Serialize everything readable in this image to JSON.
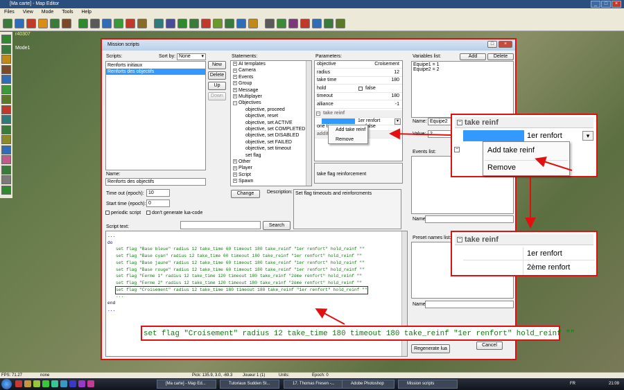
{
  "app": {
    "title": "[Ma carte] - Map Editor",
    "menu": [
      "Files",
      "View",
      "Mode",
      "Tools",
      "Help"
    ],
    "viewport_label": "r40307",
    "mode_label": "Mode1"
  },
  "dialog": {
    "title": "Mission scripts",
    "scripts_label": "Scripts:",
    "sort_label": "Sort by:",
    "sort_value": "None",
    "scripts": [
      "Renforts initiaux",
      "Renforts des objectifs"
    ],
    "buttons": {
      "new": "New",
      "delete": "Delete",
      "up": "Up",
      "down": "Down"
    },
    "name_label": "Name:",
    "name_value": "Renforts des objectifs",
    "timeout_label": "Time out (epoch):",
    "timeout_value": "10",
    "start_label": "Start time (epoch):",
    "start_value": "0",
    "periodic_label": "periodic script",
    "nolua_label": "don't generate lua-code",
    "script_text_label": "Script text:",
    "search_btn": "Search",
    "statements_label": "Statements:",
    "statements_top": [
      "AI templates",
      "Camera",
      "Events",
      "Group",
      "Message",
      "Multiplayer"
    ],
    "objectives_label": "Objectives",
    "objectives_children": [
      "objective, proceed",
      "objective, reset",
      "objective, set ACTIVE",
      "objective, set COMPLETED",
      "objective, set DISABLED",
      "objective, set FAILED",
      "objective, set timeout",
      "set flag"
    ],
    "statements_bottom": [
      "Other",
      "Player",
      "Script",
      "Spawn"
    ],
    "change_btn": "Change",
    "description_label": "Description:",
    "description_text": "Set flag timeouts and reinforcments",
    "parameters_label": "Parameters:",
    "params": [
      {
        "k": "objective",
        "v": "Croisement"
      },
      {
        "k": "radius",
        "v": "12"
      },
      {
        "k": "take time",
        "v": "180"
      },
      {
        "k": "hold",
        "v": "false"
      },
      {
        "k": "timeout",
        "v": "180"
      },
      {
        "k": "alliance",
        "v": "-1"
      }
    ],
    "take_reinf_label": "take reinf",
    "take_reinf_value": "1er renfort",
    "one_time_label": "one time",
    "one_time_value": "false",
    "additional_label": "additional objectives",
    "param_desc": "take flag reinforcement",
    "context_menu": [
      "Add take reinf",
      "Remove"
    ],
    "variables_label": "Variables list:",
    "var_add": "Add",
    "var_delete": "Delete",
    "variables": [
      "Equipe1 = 1",
      "Equipe2 = 2"
    ],
    "var_name_label": "Name:",
    "var_name_value": "Equipe2",
    "var_value_label": "Value:",
    "var_value_value": "2",
    "events_label": "Events list:",
    "events_name_label": "Name:",
    "preset_label": "Preset names list:",
    "preset_name_label": "Name:",
    "regen_btn": "Regenerate lua",
    "cancel_btn": "Cancel",
    "code_lines": [
      "...",
      "do",
      "set flag \"Base bleue\" radius 12 take_time 60 timeout 180 take_reinf \"1er renfort\" hold_reinf \"\"",
      "set flag \"Base cyan\" radius 12 take_time 60 timeout 180 take_reinf \"1er renfort\" hold_reinf \"\"",
      "set flag \"Base jaune\" radius 12 take_time 60 timeout 180 take_reinf \"1er renfort\" hold_reinf \"\"",
      "set flag \"Base rouge\" radius 12 take_time 60 timeout 180 take_reinf \"1er renfort\" hold_reinf \"\"",
      "set flag \"Ferme 1\" radius 12 take_time 120 timeout 180 take_reinf \"2ème renfort\" hold_reinf \"\"",
      "set flag \"Ferme 2\" radius 12 take_time 120 timeout 180 take_reinf \"2ème renfort\" hold_reinf \"\"",
      "set flag \"Croisement\" radius 12 take_time 180 timeout 180 take_reinf \"1er renfort\" hold_reinf \"\"",
      "...",
      "end",
      "..."
    ]
  },
  "zoom1": {
    "header": "take reinf",
    "value": "1er renfort",
    "menu": [
      "Add take reinf",
      "Remove"
    ]
  },
  "zoom2": {
    "header": "take reinf",
    "values": [
      "1er renfort",
      "2ème renfort"
    ]
  },
  "zoom3": {
    "code": "set flag \"Croisement\" radius 12 take_time 180 timeout 180 take_reinf \"1er renfort\" hold_reinf \"\""
  },
  "status": {
    "fps": "FPS: 71.27",
    "sel": "none",
    "pick": "Pick: 135.9, 3.0, -69.3",
    "player": "Joueur 1 (1)",
    "units": "Units:",
    "epoch": "Epoch: 0"
  },
  "taskbar": {
    "items": [
      "[Ma carte] - Map Ed...",
      "Tutoriaux Sudden St...",
      "17. Thomas Fresen -...",
      "Adobe Photoshop",
      "Mission scripts"
    ],
    "lang": "FR",
    "clock": "21:09"
  },
  "colors": {
    "accent": "#3399ff",
    "highlight": "#e01010",
    "code_green": "#117a11"
  }
}
